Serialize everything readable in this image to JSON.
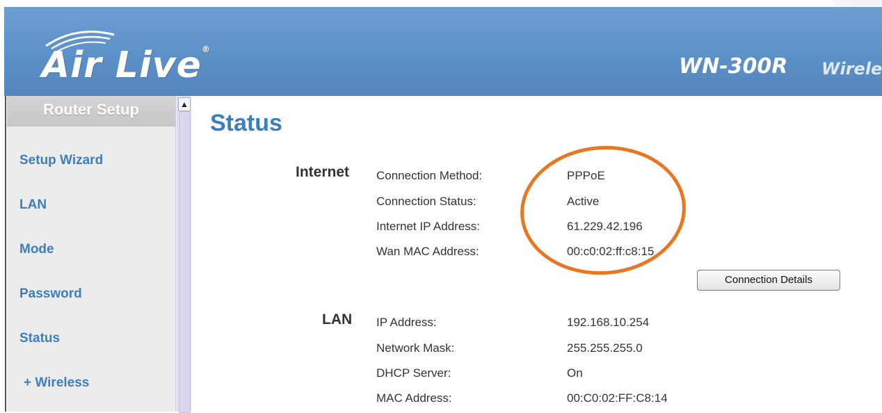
{
  "header": {
    "brand": "Air Live",
    "model": "WN-300R",
    "model_suffix": "Wirele"
  },
  "sidebar": {
    "heading": "Router Setup",
    "items": [
      {
        "label": "Setup Wizard"
      },
      {
        "label": "LAN"
      },
      {
        "label": "Mode"
      },
      {
        "label": "Password"
      },
      {
        "label": "Status"
      },
      {
        "label": "+ Wireless"
      }
    ]
  },
  "main": {
    "title": "Status",
    "internet": {
      "heading": "Internet",
      "rows": [
        {
          "label": "Connection Method:",
          "value": "PPPoE"
        },
        {
          "label": "Connection Status:",
          "value": "Active"
        },
        {
          "label": "Internet IP Address:",
          "value": "61.229.42.196"
        },
        {
          "label": "Wan MAC Address:",
          "value": "00:c0:02:ff:c8:15"
        }
      ],
      "button_label": "Connection Details"
    },
    "lan": {
      "heading": "LAN",
      "rows": [
        {
          "label": "IP Address:",
          "value": "192.168.10.254"
        },
        {
          "label": "Network Mask:",
          "value": "255.255.255.0"
        },
        {
          "label": "DHCP Server:",
          "value": "On"
        },
        {
          "label": "MAC Address:",
          "value": "00:C0:02:FF:C8:14"
        }
      ]
    }
  },
  "colors": {
    "header_blue": "#5a8fc6",
    "link_blue": "#3d7ec0",
    "highlight_orange": "#e87722"
  }
}
